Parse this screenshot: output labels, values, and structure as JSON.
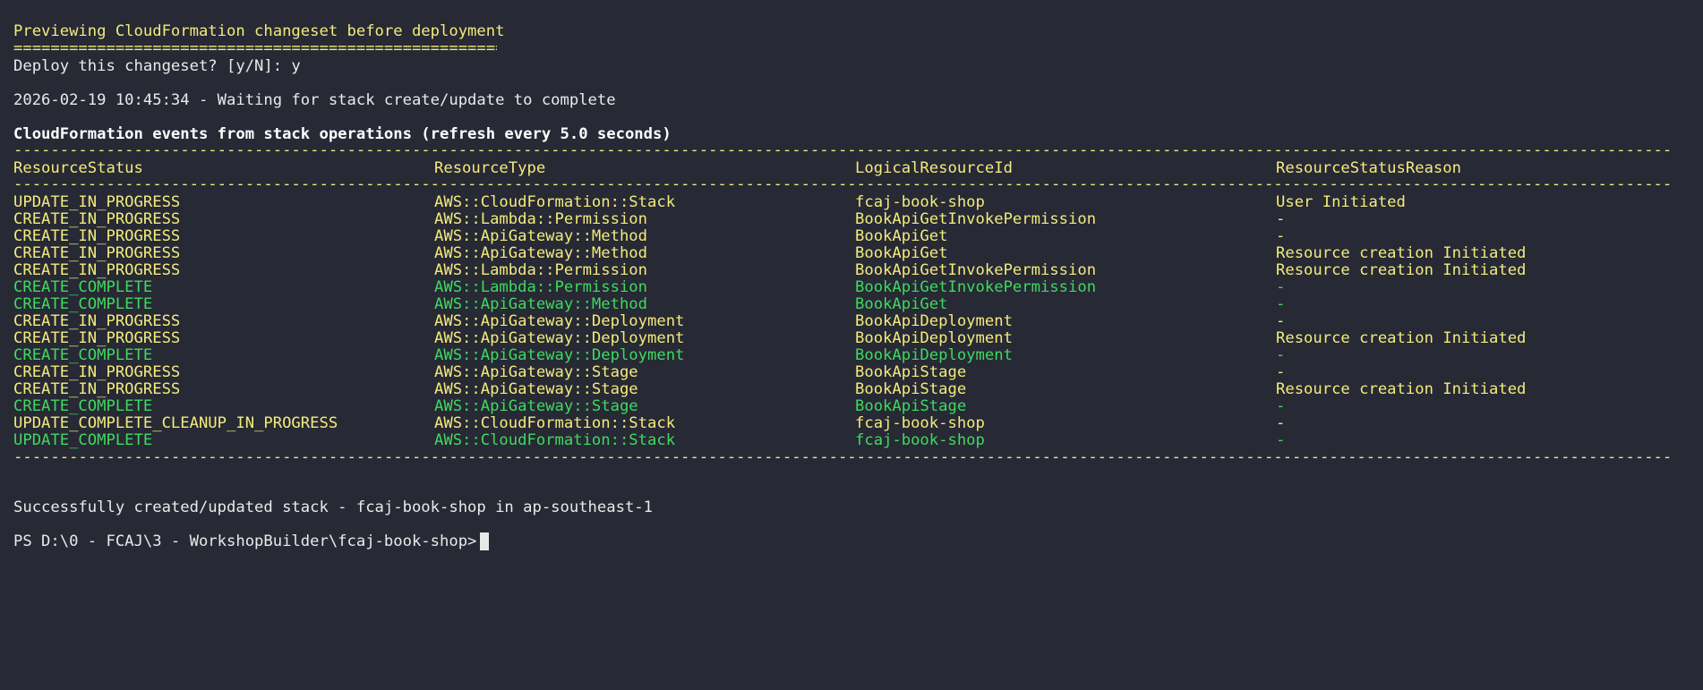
{
  "preview": {
    "title": "Previewing CloudFormation changeset before deployment",
    "underline": "=====================================================",
    "prompt": "Deploy this changeset? [y/N]: y"
  },
  "waiting": "2026-02-19 10:45:34 - Waiting for stack create/update to complete",
  "events": {
    "heading": "CloudFormation events from stack operations (refresh every 5.0 seconds)",
    "columns": [
      "ResourceStatus",
      "ResourceType",
      "LogicalResourceId",
      "ResourceStatusReason"
    ],
    "rows": [
      {
        "status": "UPDATE_IN_PROGRESS",
        "type": "AWS::CloudFormation::Stack",
        "id": "fcaj-book-shop",
        "reason": "User Initiated",
        "color": "yellow"
      },
      {
        "status": "CREATE_IN_PROGRESS",
        "type": "AWS::Lambda::Permission",
        "id": "BookApiGetInvokePermission",
        "reason": "-",
        "color": "yellow"
      },
      {
        "status": "CREATE_IN_PROGRESS",
        "type": "AWS::ApiGateway::Method",
        "id": "BookApiGet",
        "reason": "-",
        "color": "yellow"
      },
      {
        "status": "CREATE_IN_PROGRESS",
        "type": "AWS::ApiGateway::Method",
        "id": "BookApiGet",
        "reason": "Resource creation Initiated",
        "color": "yellow"
      },
      {
        "status": "CREATE_IN_PROGRESS",
        "type": "AWS::Lambda::Permission",
        "id": "BookApiGetInvokePermission",
        "reason": "Resource creation Initiated",
        "color": "yellow"
      },
      {
        "status": "CREATE_COMPLETE",
        "type": "AWS::Lambda::Permission",
        "id": "BookApiGetInvokePermission",
        "reason": "-",
        "color": "green"
      },
      {
        "status": "CREATE_COMPLETE",
        "type": "AWS::ApiGateway::Method",
        "id": "BookApiGet",
        "reason": "-",
        "color": "green"
      },
      {
        "status": "CREATE_IN_PROGRESS",
        "type": "AWS::ApiGateway::Deployment",
        "id": "BookApiDeployment",
        "reason": "-",
        "color": "yellow"
      },
      {
        "status": "CREATE_IN_PROGRESS",
        "type": "AWS::ApiGateway::Deployment",
        "id": "BookApiDeployment",
        "reason": "Resource creation Initiated",
        "color": "yellow"
      },
      {
        "status": "CREATE_COMPLETE",
        "type": "AWS::ApiGateway::Deployment",
        "id": "BookApiDeployment",
        "reason": "-",
        "color": "green"
      },
      {
        "status": "CREATE_IN_PROGRESS",
        "type": "AWS::ApiGateway::Stage",
        "id": "BookApiStage",
        "reason": "-",
        "color": "yellow"
      },
      {
        "status": "CREATE_IN_PROGRESS",
        "type": "AWS::ApiGateway::Stage",
        "id": "BookApiStage",
        "reason": "Resource creation Initiated",
        "color": "yellow"
      },
      {
        "status": "CREATE_COMPLETE",
        "type": "AWS::ApiGateway::Stage",
        "id": "BookApiStage",
        "reason": "-",
        "color": "green"
      },
      {
        "status": "UPDATE_COMPLETE_CLEANUP_IN_PROGRESS",
        "type": "AWS::CloudFormation::Stack",
        "id": "fcaj-book-shop",
        "reason": "-",
        "color": "yellow"
      },
      {
        "status": "UPDATE_COMPLETE",
        "type": "AWS::CloudFormation::Stack",
        "id": "fcaj-book-shop",
        "reason": "-",
        "color": "green"
      }
    ]
  },
  "result": "Successfully created/updated stack - fcaj-book-shop in ap-southeast-1",
  "shell_prompt": "PS D:\\0 - FCAJ\\3 - WorkshopBuilder\\fcaj-book-shop>",
  "colors": {
    "background": "#272935",
    "yellow": "#f3eb7c",
    "green": "#3fd95f"
  }
}
